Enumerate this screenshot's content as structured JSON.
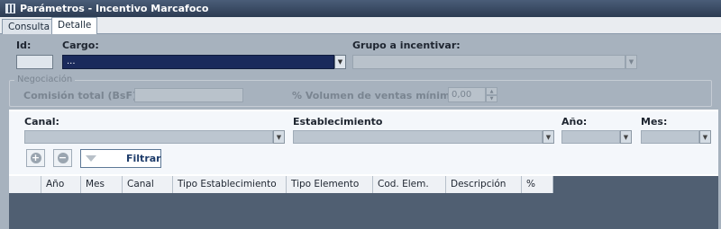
{
  "window": {
    "title": "Parámetros - Incentivo Marcafoco"
  },
  "tabs": [
    {
      "label": "Consulta",
      "active": false
    },
    {
      "label": "Detalle",
      "active": true
    }
  ],
  "form": {
    "id_label": "Id:",
    "id_value": "",
    "cargo_label": "Cargo:",
    "cargo_value": "...",
    "grupo_label": "Grupo a incentivar:",
    "grupo_value": ""
  },
  "negociacion": {
    "title": "Negociación",
    "comision_label": "Comisión total (BsF):",
    "comision_value": "",
    "volumen_label": "% Volumen de ventas mínimo:",
    "volumen_value": "0,00"
  },
  "filters": {
    "canal_label": "Canal:",
    "establecimiento_label": "Establecimiento",
    "anio_label": "Año:",
    "mes_label": "Mes:",
    "filtrar_label": "Filtrar"
  },
  "grid": {
    "columns": [
      "",
      "Año",
      "Mes",
      "Canal",
      "Tipo Establecimiento",
      "Tipo Elemento",
      "Cod. Elem.",
      "Descripción",
      "%"
    ]
  },
  "colors": {
    "titlebar": "#2c3b52",
    "panel": "#a7b2be",
    "selected_field": "#1a2a5c",
    "grid_background": "#505f72"
  }
}
